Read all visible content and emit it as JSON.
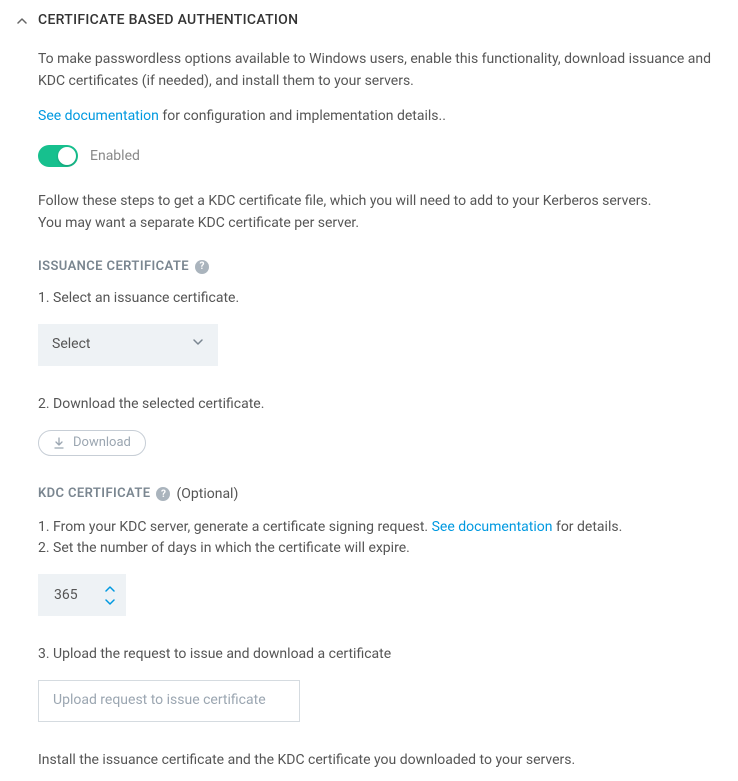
{
  "header": {
    "title": "CERTIFICATE BASED AUTHENTICATION"
  },
  "intro": "To make passwordless options available to Windows users, enable this functionality, download issuance and KDC certificates (if needed), and install them to your servers.",
  "doc_link": {
    "link_text": "See documentation",
    "suffix": " for configuration and implementation details.."
  },
  "toggle": {
    "label": "Enabled"
  },
  "steps_intro_line1": "Follow these steps to get a KDC certificate file, which you will need to add to your Kerberos servers.",
  "steps_intro_line2": "You may want a separate KDC certificate per server.",
  "issuance": {
    "heading": "ISSUANCE CERTIFICATE",
    "step1": "1. Select an issuance certificate.",
    "select_label": "Select",
    "step2": "2. Download the selected certificate.",
    "download_label": "Download"
  },
  "kdc": {
    "heading": "KDC CERTIFICATE",
    "optional": "(Optional)",
    "step1_prefix": "1. From your KDC server, generate a certificate signing request. ",
    "step1_link": "See documentation",
    "step1_suffix": " for details.",
    "step2": "2. Set the number of days in which the certificate will expire.",
    "days_value": "365",
    "step3": "3. Upload the request to issue and download a certificate",
    "upload_placeholder": "Upload request to issue certificate"
  },
  "footer_text": "Install the issuance certificate and the KDC certificate you downloaded to your servers."
}
